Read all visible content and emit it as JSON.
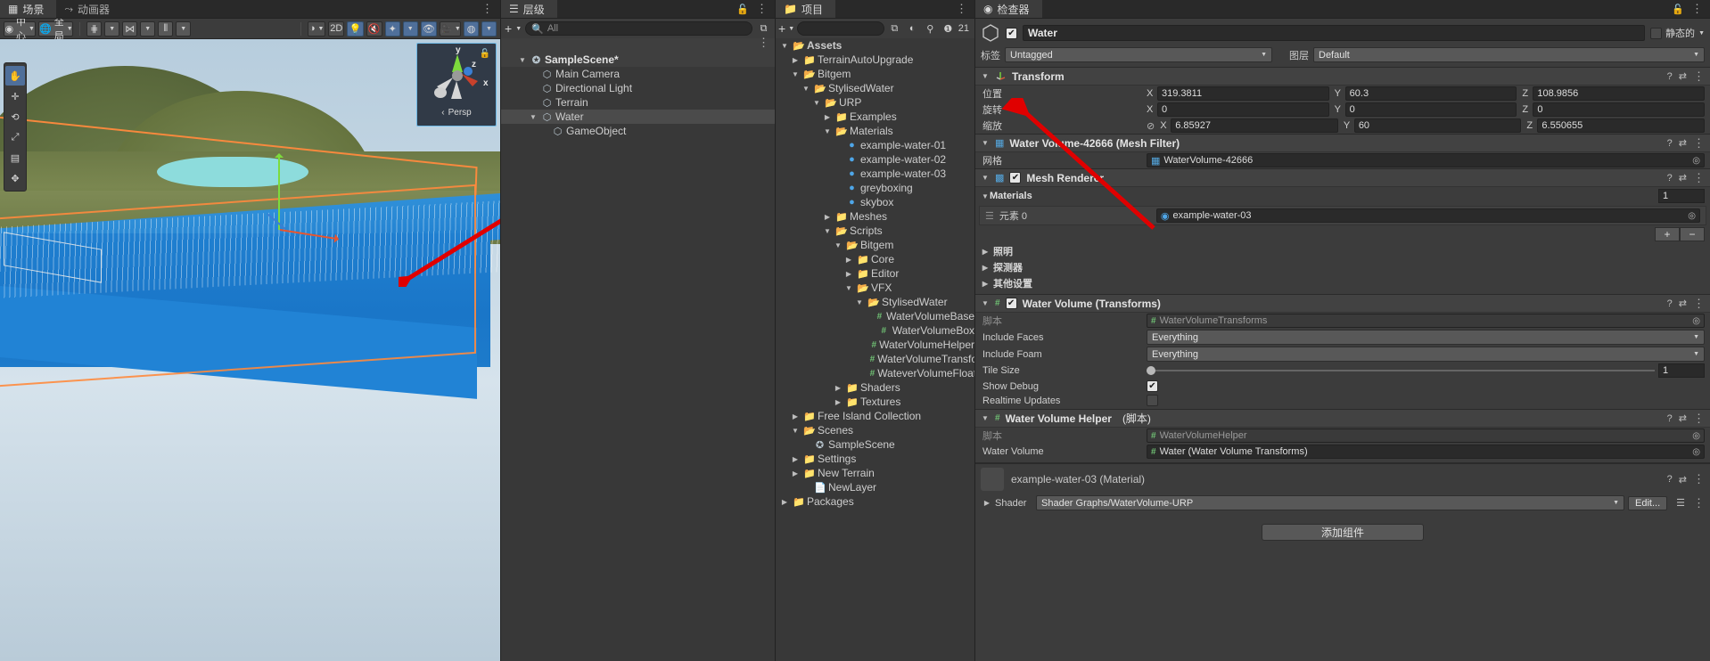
{
  "scene": {
    "tabs": [
      {
        "label": "场景",
        "icon": "grid-icon",
        "active": true
      },
      {
        "label": "动画器",
        "icon": "animator-icon",
        "active": false
      }
    ],
    "toolbar": {
      "pivot_label": "中心",
      "space_label": "全局",
      "grid_snap_icon": "grid-snap-icon",
      "vertex_snap_icon": "vertex-snap-icon",
      "ruler_icon": "ruler-icon",
      "shading_icon": "shading-sphere-icon",
      "two_d_label": "2D",
      "light_icon": "lightbulb-icon",
      "audio_icon": "audio-mute-icon",
      "fx_icon": "effects-icon"
    },
    "gizmo": {
      "x_label": "x",
      "y_label": "y",
      "z_label": "z",
      "projection_label": "Persp",
      "lock_icon": "lock-icon"
    },
    "annotation_arrow": "red-arrow-pointing-to-water"
  },
  "hierarchy": {
    "tab_label": "层级",
    "add_label": "+",
    "search_placeholder": "All",
    "lock_icon": "lock-icon",
    "items": [
      {
        "label": "SampleScene*",
        "depth": 0,
        "arrow": "down",
        "icon": "unity-scene-icon",
        "selected": false,
        "header": true
      },
      {
        "label": "Main Camera",
        "depth": 1,
        "arrow": "none",
        "icon": "gameobject-icon",
        "selected": false
      },
      {
        "label": "Directional Light",
        "depth": 1,
        "arrow": "none",
        "icon": "gameobject-icon",
        "selected": false
      },
      {
        "label": "Terrain",
        "depth": 1,
        "arrow": "none",
        "icon": "gameobject-icon",
        "selected": false
      },
      {
        "label": "Water",
        "depth": 1,
        "arrow": "down",
        "icon": "gameobject-icon",
        "selected": true
      },
      {
        "label": "GameObject",
        "depth": 2,
        "arrow": "none",
        "icon": "gameobject-icon",
        "selected": false
      }
    ]
  },
  "project": {
    "tab_label": "项目",
    "add_label": "+",
    "count_label": "21",
    "items": [
      {
        "label": "Assets",
        "depth": 0,
        "arrow": "down",
        "icon": "folder-open-icon",
        "bold": true
      },
      {
        "label": "TerrainAutoUpgrade",
        "depth": 1,
        "arrow": "right",
        "icon": "folder-icon"
      },
      {
        "label": "Bitgem",
        "depth": 1,
        "arrow": "down",
        "icon": "folder-open-icon"
      },
      {
        "label": "StylisedWater",
        "depth": 2,
        "arrow": "down",
        "icon": "folder-open-icon"
      },
      {
        "label": "URP",
        "depth": 3,
        "arrow": "down",
        "icon": "folder-open-icon"
      },
      {
        "label": "Examples",
        "depth": 4,
        "arrow": "right",
        "icon": "folder-icon"
      },
      {
        "label": "Materials",
        "depth": 4,
        "arrow": "down",
        "icon": "folder-open-icon"
      },
      {
        "label": "example-water-01",
        "depth": 5,
        "arrow": "none",
        "icon": "material-icon"
      },
      {
        "label": "example-water-02",
        "depth": 5,
        "arrow": "none",
        "icon": "material-icon"
      },
      {
        "label": "example-water-03",
        "depth": 5,
        "arrow": "none",
        "icon": "material-icon"
      },
      {
        "label": "greyboxing",
        "depth": 5,
        "arrow": "none",
        "icon": "material-icon"
      },
      {
        "label": "skybox",
        "depth": 5,
        "arrow": "none",
        "icon": "material-icon"
      },
      {
        "label": "Meshes",
        "depth": 4,
        "arrow": "right",
        "icon": "folder-icon"
      },
      {
        "label": "Scripts",
        "depth": 4,
        "arrow": "down",
        "icon": "folder-open-icon"
      },
      {
        "label": "Bitgem",
        "depth": 5,
        "arrow": "down",
        "icon": "folder-open-icon"
      },
      {
        "label": "Core",
        "depth": 6,
        "arrow": "right",
        "icon": "folder-icon"
      },
      {
        "label": "Editor",
        "depth": 6,
        "arrow": "right",
        "icon": "folder-icon"
      },
      {
        "label": "VFX",
        "depth": 6,
        "arrow": "down",
        "icon": "folder-open-icon"
      },
      {
        "label": "StylisedWater",
        "depth": 7,
        "arrow": "down",
        "icon": "folder-open-icon"
      },
      {
        "label": "WaterVolumeBase",
        "depth": 8,
        "arrow": "none",
        "icon": "script-icon"
      },
      {
        "label": "WaterVolumeBox",
        "depth": 8,
        "arrow": "none",
        "icon": "script-icon"
      },
      {
        "label": "WaterVolumeHelper",
        "depth": 8,
        "arrow": "none",
        "icon": "script-icon"
      },
      {
        "label": "WaterVolumeTransfor",
        "depth": 8,
        "arrow": "none",
        "icon": "script-icon"
      },
      {
        "label": "WateverVolumeFloate",
        "depth": 8,
        "arrow": "none",
        "icon": "script-icon"
      },
      {
        "label": "Shaders",
        "depth": 5,
        "arrow": "right",
        "icon": "folder-icon"
      },
      {
        "label": "Textures",
        "depth": 5,
        "arrow": "right",
        "icon": "folder-icon"
      },
      {
        "label": "Free Island Collection",
        "depth": 1,
        "arrow": "right",
        "icon": "folder-icon"
      },
      {
        "label": "Scenes",
        "depth": 1,
        "arrow": "down",
        "icon": "folder-open-icon"
      },
      {
        "label": "SampleScene",
        "depth": 2,
        "arrow": "none",
        "icon": "unity-scene-icon"
      },
      {
        "label": "Settings",
        "depth": 1,
        "arrow": "right",
        "icon": "folder-icon"
      },
      {
        "label": "New Terrain",
        "depth": 1,
        "arrow": "right",
        "icon": "folder-icon"
      },
      {
        "label": "NewLayer",
        "depth": 2,
        "arrow": "none",
        "icon": "file-icon"
      },
      {
        "label": "Packages",
        "depth": 0,
        "arrow": "right",
        "icon": "folder-icon"
      }
    ]
  },
  "inspector": {
    "tab_label": "检查器",
    "lock_icon": "lock-icon",
    "object": {
      "enabled": true,
      "name": "Water",
      "static_label": "静态的",
      "tag_label": "标签",
      "tag_value": "Untagged",
      "layer_label": "图层",
      "layer_value": "Default"
    },
    "transform": {
      "title": "Transform",
      "position_label": "位置",
      "rotation_label": "旋转",
      "scale_label": "缩放",
      "position": {
        "x": "319.3811",
        "y": "60.3",
        "z": "108.9856"
      },
      "rotation": {
        "x": "0",
        "y": "0",
        "z": "0"
      },
      "scale": {
        "x": "6.85927",
        "y": "60",
        "z": "6.550655"
      },
      "axis_x": "X",
      "axis_y": "Y",
      "axis_z": "Z",
      "uniform_scale_icon": "link-off-icon"
    },
    "mesh_filter": {
      "title": "Water Volume-42666 (Mesh Filter)",
      "mesh_label": "网格",
      "mesh_value": "WaterVolume-42666"
    },
    "mesh_renderer": {
      "title": "Mesh Renderer",
      "enabled": true,
      "materials_label": "Materials",
      "materials_count": "1",
      "element_label": "元素 0",
      "element_value": "example-water-03",
      "add_label": "+",
      "remove_label": "−",
      "sections": [
        "照明",
        "探测器",
        "其他设置"
      ]
    },
    "water_volume_transforms": {
      "title": "Water  Volume (Transforms)",
      "enabled": true,
      "script_label": "脚本",
      "script_value": "WaterVolumeTransforms",
      "fields": [
        {
          "label": "Include Faces",
          "type": "dropdown",
          "value": "Everything"
        },
        {
          "label": "Include Foam",
          "type": "dropdown",
          "value": "Everything"
        },
        {
          "label": "Tile Size",
          "type": "slider",
          "value": "1"
        },
        {
          "label": "Show Debug",
          "type": "checkbox",
          "value": true
        },
        {
          "label": "Realtime Updates",
          "type": "checkbox",
          "value": false
        }
      ]
    },
    "water_volume_helper": {
      "title": "Water Volume Helper",
      "title_suffix": "(脚本)",
      "script_label": "脚本",
      "script_value": "WaterVolumeHelper",
      "water_volume_label": "Water Volume",
      "water_volume_value": "Water (Water Volume Transforms)"
    },
    "material_preview": {
      "title": "example-water-03 (Material)",
      "shader_label": "Shader",
      "shader_value": "Shader Graphs/WaterVolume-URP",
      "edit_label": "Edit..."
    },
    "add_component_label": "添加组件"
  },
  "colors": {
    "accent_blue": "#4f6f9a",
    "selection_orange": "#ff8a3d",
    "annotation_red": "#e00000",
    "material_blue": "#4ea6e8",
    "script_green": "#6fbf73"
  }
}
